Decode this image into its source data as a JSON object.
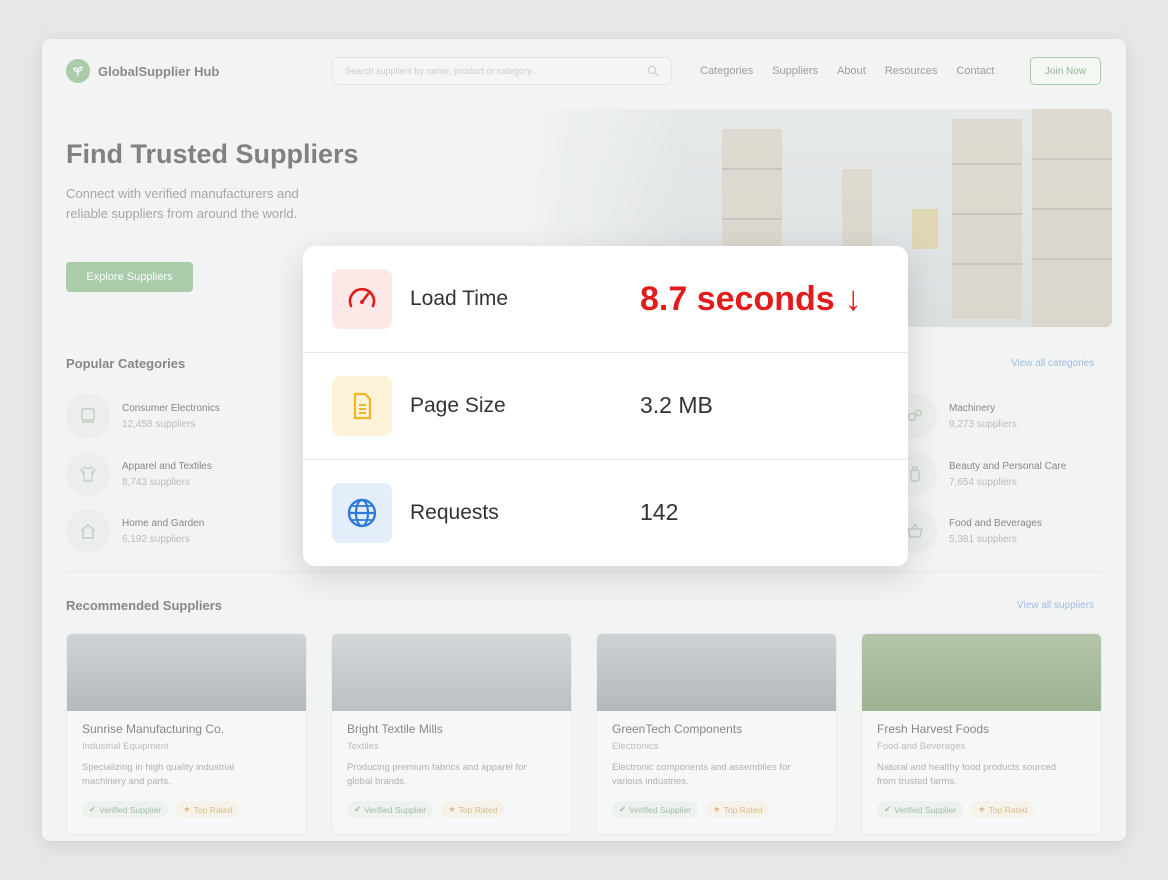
{
  "brand": {
    "name": "GlobalSupplier Hub"
  },
  "search": {
    "placeholder": "Search suppliers by name, product or category..."
  },
  "nav": {
    "items": [
      "Categories",
      "Suppliers",
      "About",
      "Resources",
      "Contact"
    ],
    "join_label": "Join Now"
  },
  "hero": {
    "title": "Find Trusted Suppliers",
    "subtitle": "Connect with verified manufacturers and reliable suppliers from around the world.",
    "cta": "Explore Suppliers"
  },
  "categories": {
    "title": "Popular Categories",
    "view_all": "View all categories",
    "items": [
      {
        "name": "Consumer Electronics",
        "count": "12,458 suppliers",
        "icon": "monitor-icon"
      },
      {
        "name": "Apparel and Textiles",
        "count": "8,743 suppliers",
        "icon": "shirt-icon"
      },
      {
        "name": "Home and Garden",
        "count": "6,192 suppliers",
        "icon": "home-icon"
      },
      {
        "name": "Machinery",
        "count": "9,273 suppliers",
        "icon": "gears-icon"
      },
      {
        "name": "Beauty and Personal Care",
        "count": "7,654 suppliers",
        "icon": "bottle-icon"
      },
      {
        "name": "Food and Beverages",
        "count": "5,381 suppliers",
        "icon": "basket-icon"
      }
    ]
  },
  "suppliers": {
    "title": "Recommended Suppliers",
    "view_all": "View all suppliers",
    "verified_label": "Verified Supplier",
    "top_label": "Top Rated",
    "items": [
      {
        "name": "Sunrise Manufacturing Co.",
        "type": "Industrial Equipment",
        "desc": "Specializing in high quality industrial machinery and parts."
      },
      {
        "name": "Bright Textile Mills",
        "type": "Textiles",
        "desc": "Producing premium fabrics and apparel for global brands."
      },
      {
        "name": "GreenTech Components",
        "type": "Electronics",
        "desc": "Electronic components and assemblies for various industries."
      },
      {
        "name": "Fresh Harvest Foods",
        "type": "Food and Beverages",
        "desc": "Natural and healthy food products sourced from trusted farms."
      }
    ]
  },
  "metrics": [
    {
      "label": "Load Time",
      "value": "8.7 seconds",
      "icon": "speedometer-icon",
      "trend": "down",
      "color": "#e31b1b"
    },
    {
      "label": "Page Size",
      "value": "3.2 MB",
      "icon": "document-icon",
      "color": "#f0b429"
    },
    {
      "label": "Requests",
      "value": "142",
      "icon": "globe-icon",
      "color": "#2f7ad6"
    }
  ],
  "colors": {
    "accent": "#7fb37f",
    "alert": "#e31b1b",
    "link": "#6f9bd4"
  }
}
